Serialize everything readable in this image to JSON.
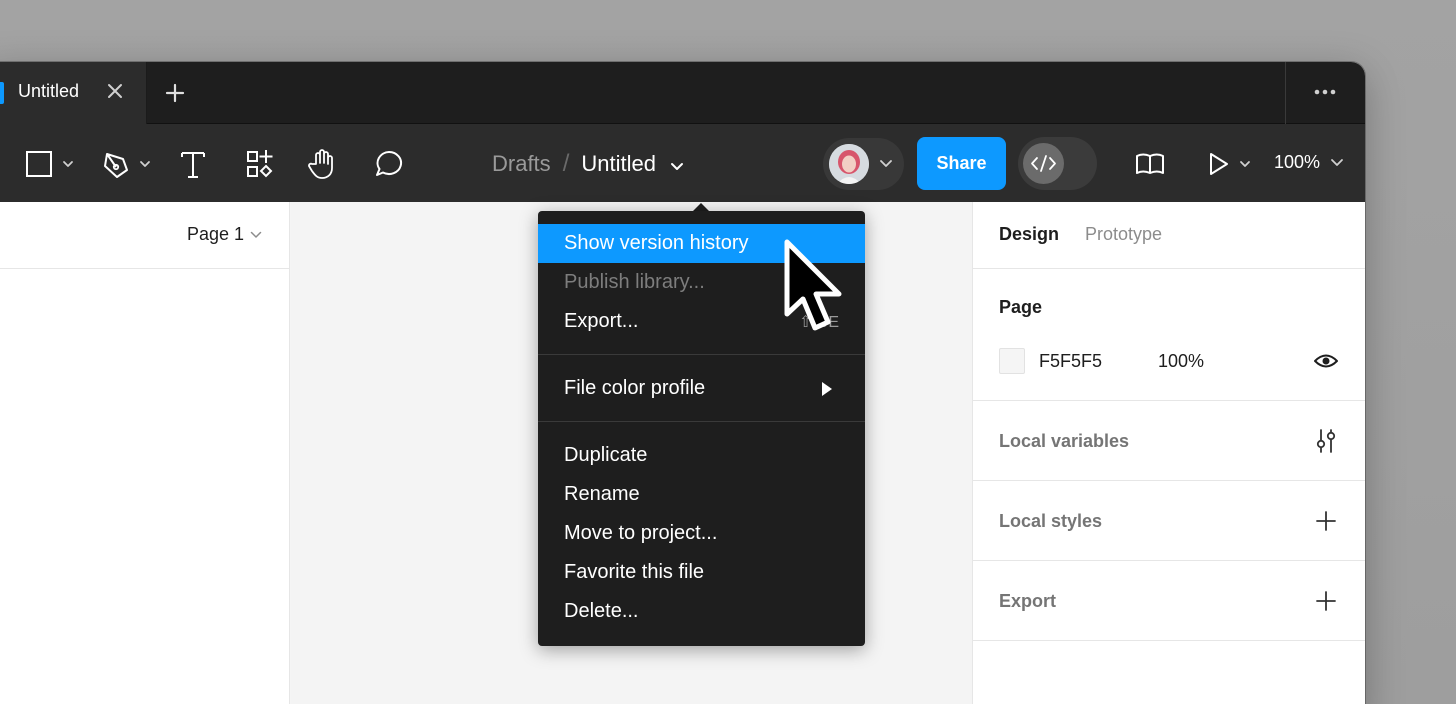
{
  "tab": {
    "title": "Untitled"
  },
  "toolbar": {
    "breadcrumb": {
      "parent": "Drafts",
      "separator": "/",
      "title": "Untitled"
    },
    "share_label": "Share",
    "zoom": "100%",
    "icons": [
      "rectangle-tool-icon",
      "pen-tool-icon",
      "text-tool-icon",
      "resources-icon",
      "hand-tool-icon",
      "comment-icon",
      "library-icon",
      "present-icon"
    ]
  },
  "left_panel": {
    "page_selector": "Page 1"
  },
  "right_panel": {
    "tabs": [
      {
        "label": "Design",
        "active": true
      },
      {
        "label": "Prototype",
        "active": false
      }
    ],
    "page": {
      "title": "Page",
      "color_hex": "F5F5F5",
      "opacity": "100%"
    },
    "sections": [
      {
        "title": "Local variables",
        "icon": "sliders-icon"
      },
      {
        "title": "Local styles",
        "icon": "plus-icon"
      },
      {
        "title": "Export",
        "icon": "plus-icon"
      }
    ]
  },
  "menu": {
    "items": [
      {
        "label": "Show version history",
        "state": "highlighted"
      },
      {
        "label": "Publish library...",
        "state": "disabled"
      },
      {
        "label": "Export...",
        "shortcut": "⇧⌘E"
      },
      {
        "label": "File color profile",
        "submenu": true
      },
      {
        "label": "Duplicate"
      },
      {
        "label": "Rename"
      },
      {
        "label": "Move to project..."
      },
      {
        "label": "Favorite this file"
      },
      {
        "label": "Delete..."
      }
    ]
  },
  "colors": {
    "accent": "#0d99ff",
    "toolbar": "#2c2c2c",
    "tabbar": "#1e1e1e",
    "canvas": "#f4f4f4"
  }
}
